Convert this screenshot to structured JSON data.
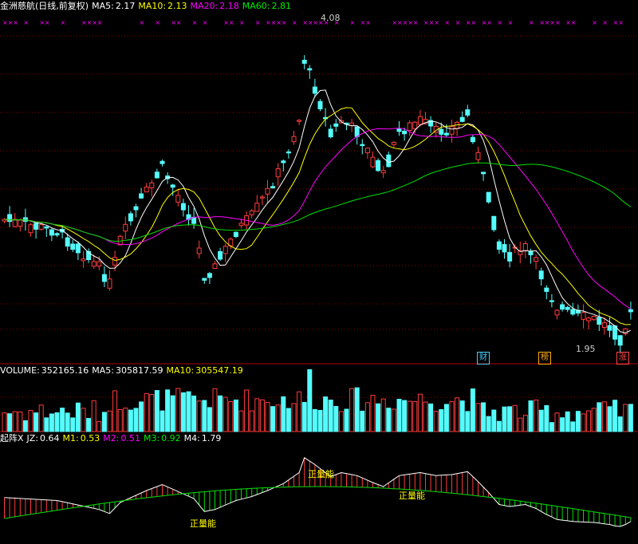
{
  "colors": {
    "up": "#ff3c3c",
    "down": "#54fcfc",
    "ma5": "#ffffff",
    "ma10": "#ffff00",
    "ma20": "#ff00ff",
    "ma60": "#00e000",
    "grid": "#8b0000",
    "text": "#ffffff",
    "marker": "#ff00ff"
  },
  "price_header": {
    "title": "金洲慈航(日线,前复权)",
    "ma5_label": "MA5:",
    "ma5": "2.17",
    "ma10_label": "MA10:",
    "ma10": "2.13",
    "ma20_label": "MA20:",
    "ma20": "2.18",
    "ma60_label": "MA60:",
    "ma60": "2.81"
  },
  "volume_header": {
    "label": "VOLUME:",
    "value": "352165.16",
    "ma5_label": "MA5:",
    "ma5": "305817.59",
    "ma10_label": "MA10:",
    "ma10": "305547.19"
  },
  "indicator_header": {
    "name": "起阵X",
    "jz_label": "JZ:",
    "jz": "0.64",
    "m1_label": "M1:",
    "m1": "0.53",
    "m2_label": "M2:",
    "m2": "0.51",
    "m3_label": "M3:",
    "m3": "0.92",
    "m4_label": "M4:",
    "m4": "1.79"
  },
  "annotations": {
    "high": "4.08",
    "low": "1.95",
    "energy": "正量能"
  },
  "tags": {
    "finance": "财",
    "rank": "榜",
    "rise": "涨"
  },
  "chart_data": {
    "type": "candlestick",
    "title": "金洲慈航(日线,前复权)",
    "price_high": 4.08,
    "price_low": 1.95,
    "moving_averages": {
      "MA5": 2.17,
      "MA10": 2.13,
      "MA20": 2.18,
      "MA60": 2.81
    },
    "volume": {
      "VOLUME": 352165.16,
      "MA5": 305817.59,
      "MA10": 305547.19
    },
    "indicator": {
      "JZ": 0.64,
      "M1": 0.53,
      "M2": 0.51,
      "M3": 0.92,
      "M4": 1.79
    }
  }
}
